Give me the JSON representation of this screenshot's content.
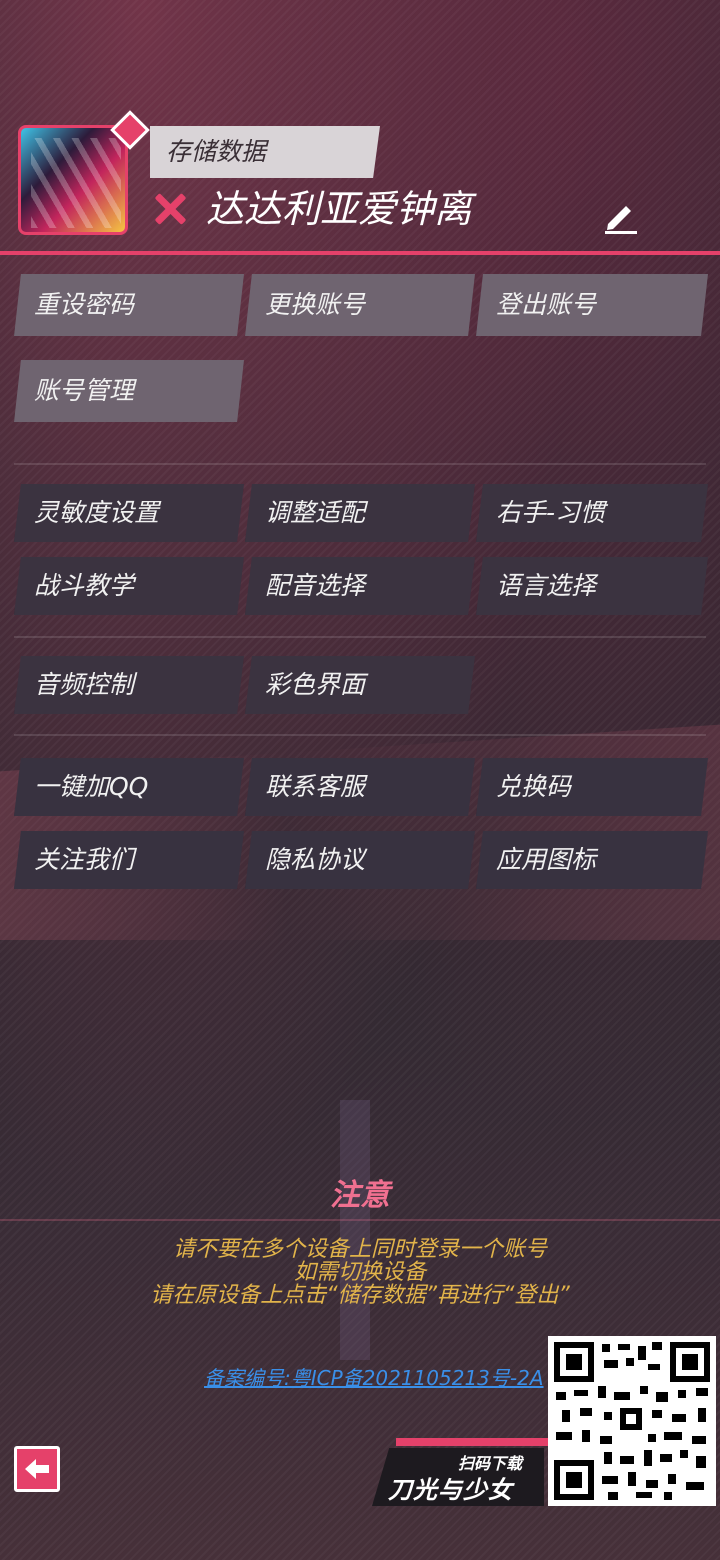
{
  "header": {
    "save_tab": "存储数据",
    "username": "达达利亚爱钟离"
  },
  "account_buttons": [
    "重设密码",
    "更换账号",
    "登出账号",
    "账号管理"
  ],
  "settings_buttons": [
    "灵敏度设置",
    "调整适配",
    "右手-习惯",
    "战斗教学",
    "配音选择",
    "语言选择"
  ],
  "display_buttons": [
    "音频控制",
    "彩色界面"
  ],
  "misc_buttons": [
    "一键加QQ",
    "联系客服",
    "兑换码",
    "关注我们",
    "隐私协议",
    "应用图标"
  ],
  "notice": {
    "title": "注意",
    "line1": "请不要在多个设备上同时登录一个账号",
    "line2": "如需切换设备",
    "line3": "请在原设备上点击“储存数据”再进行“登出”"
  },
  "icp": "备案编号:粤ICP备2021105213号-2A",
  "promo": {
    "scan": "扫码下载",
    "game": "刀光与少女"
  },
  "colors": {
    "accent": "#e5416a",
    "notice_text": "#e2b44a",
    "link": "#3a8fe8"
  }
}
